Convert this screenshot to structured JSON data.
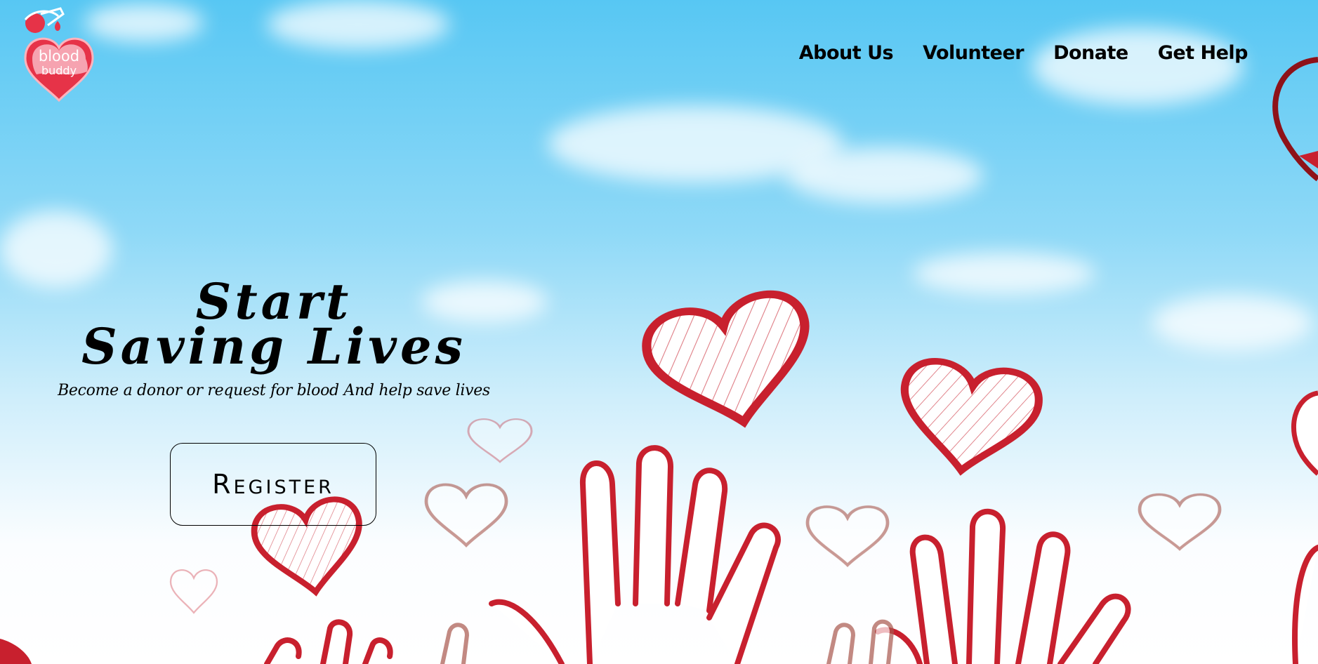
{
  "logo": {
    "line1": "blood",
    "line2": "buddy"
  },
  "nav": {
    "about": "About Us",
    "volunteer": "Volunteer",
    "donate": "Donate",
    "get_help": "Get Help"
  },
  "hero": {
    "title_line1": "Start",
    "title_line2": "Saving Lives",
    "subtitle": "Become a donor or request for blood  And help save lives",
    "register_label": "Register"
  },
  "colors": {
    "accent_red": "#c8202e",
    "logo_red": "#e63348",
    "sky": "#57c7f3"
  }
}
